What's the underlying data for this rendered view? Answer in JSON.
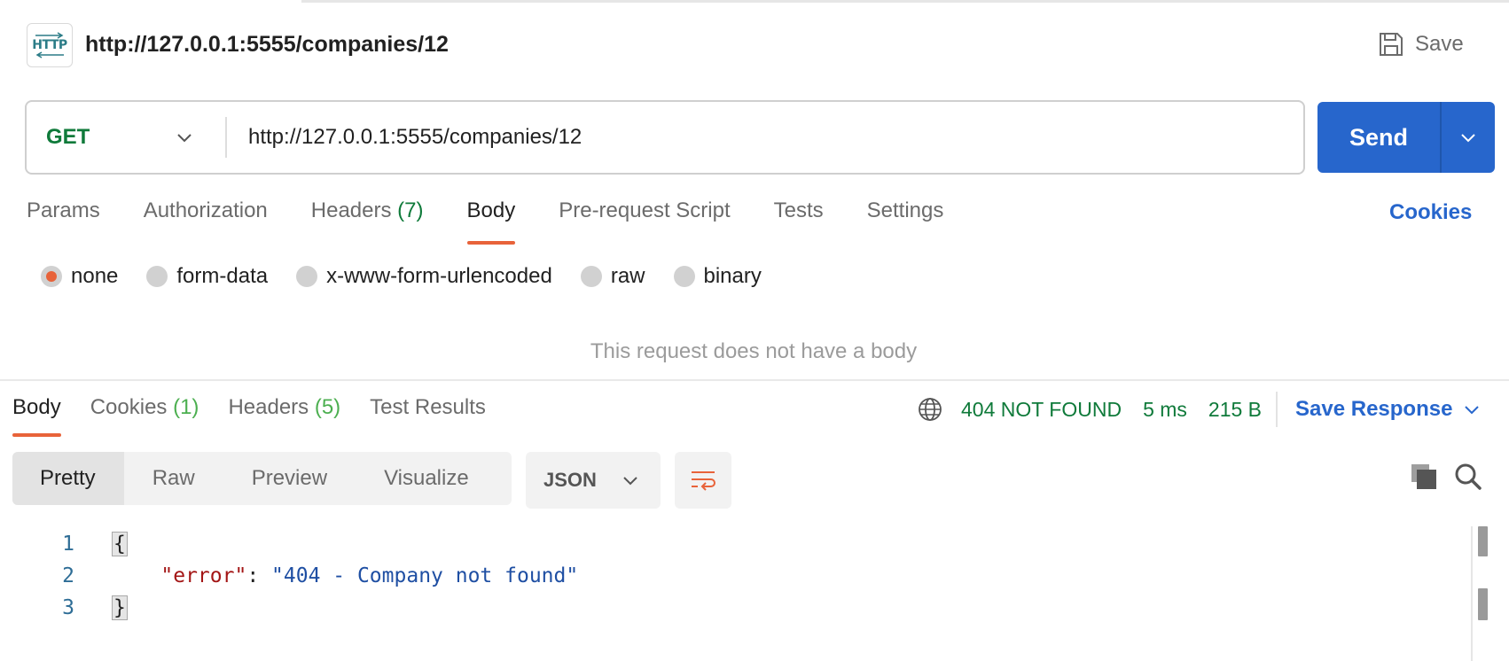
{
  "header": {
    "title": "http://127.0.0.1:5555/companies/12",
    "icon_text": "HTTP",
    "save_label": "Save"
  },
  "request": {
    "method": "GET",
    "url": "http://127.0.0.1:5555/companies/12",
    "send_label": "Send"
  },
  "request_tabs": {
    "params": "Params",
    "authorization": "Authorization",
    "headers": "Headers",
    "headers_count": "(7)",
    "body": "Body",
    "prerequest": "Pre-request Script",
    "tests": "Tests",
    "settings": "Settings",
    "cookies": "Cookies"
  },
  "body_types": {
    "none": "none",
    "form_data": "form-data",
    "urlencoded": "x-www-form-urlencoded",
    "raw": "raw",
    "binary": "binary",
    "empty_message": "This request does not have a body"
  },
  "response_tabs": {
    "body": "Body",
    "cookies": "Cookies",
    "cookies_count": "(1)",
    "headers": "Headers",
    "headers_count": "(5)",
    "test_results": "Test Results"
  },
  "response_meta": {
    "status": "404 NOT FOUND",
    "time": "5 ms",
    "size": "215 B",
    "save_response": "Save Response"
  },
  "viewer": {
    "pretty": "Pretty",
    "raw": "Raw",
    "preview": "Preview",
    "visualize": "Visualize",
    "format": "JSON"
  },
  "code": {
    "line1_num": "1",
    "line2_num": "2",
    "line3_num": "3",
    "open_brace": "{",
    "close_brace": "}",
    "key": "\"error\"",
    "colon": ": ",
    "value": "\"404 - Company not found\""
  },
  "colors": {
    "accent_orange": "#e8633a",
    "send_blue": "#2766cc",
    "method_green": "#0f7a3a"
  }
}
